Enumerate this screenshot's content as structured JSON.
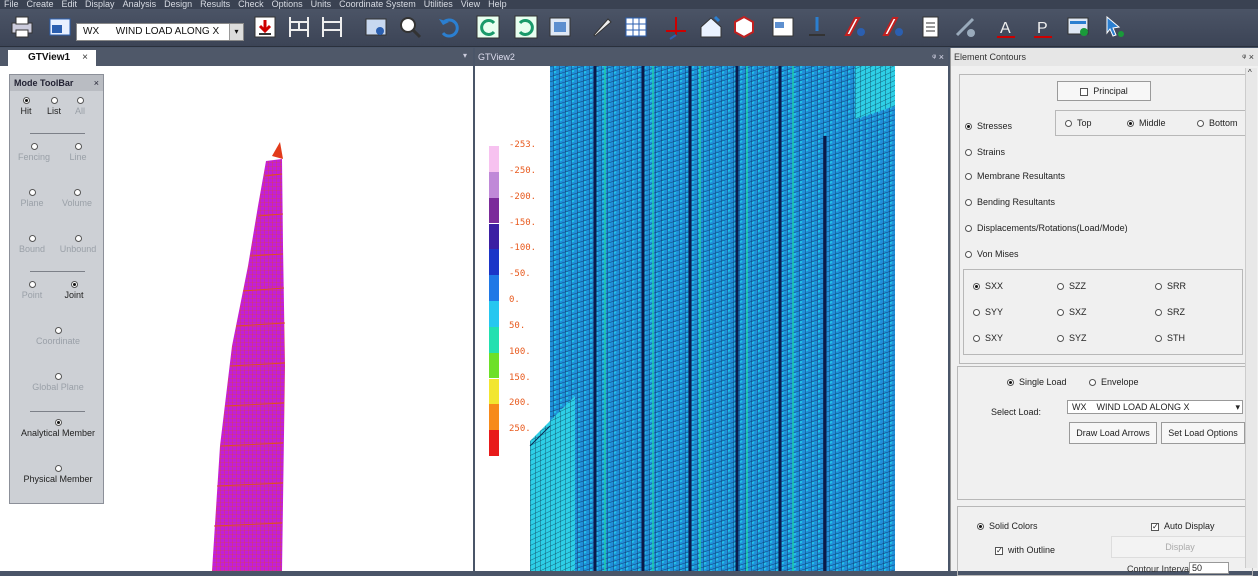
{
  "menu": [
    "File",
    "Create",
    "Edit",
    "Display",
    "Analysis",
    "Design",
    "Results",
    "Check",
    "Options",
    "Units",
    "Coordinate System",
    "Utilities",
    "View",
    "Help"
  ],
  "toolbar": {
    "load_code": "WX",
    "load_name": "WIND LOAD ALONG X",
    "icons": [
      "print-icon",
      "model-icon",
      "download-icon",
      "frame-icon",
      "frame2-icon",
      "image-icon",
      "search-icon",
      "undo-icon",
      "redo-icon",
      "redo2-icon",
      "layout-icon",
      "brush-icon",
      "grid-icon",
      "axis-icon",
      "house-icon",
      "cube-icon",
      "window-icon",
      "support-icon",
      "plate-icon",
      "plate2-icon",
      "report-icon",
      "design-icon",
      "text-a-icon",
      "text-p-icon",
      "display-icon",
      "cursor-icon"
    ]
  },
  "view1": {
    "tab": "GTView1",
    "close": "×"
  },
  "view2": {
    "title": "GTView2",
    "controls": "ᵠ ×"
  },
  "mode_toolbar": {
    "title": "Mode ToolBar",
    "close": "×",
    "row1": [
      "Hit",
      "List",
      "All"
    ],
    "fencing": "Fencing",
    "line": "Line",
    "plane": "Plane",
    "volume": "Volume",
    "bound": "Bound",
    "unbound": "Unbound",
    "point": "Point",
    "joint": "Joint",
    "coordinate": "Coordinate",
    "global_plane": "Global Plane",
    "analytical": "Analytical Member",
    "physical": "Physical Member"
  },
  "legend": {
    "values": [
      "-253.",
      "-250.",
      "-200.",
      "-150.",
      "-100.",
      "-50.",
      "0.",
      "50.",
      "100.",
      "150.",
      "200.",
      "250."
    ],
    "colors": [
      "#f7c2f0",
      "#c089d8",
      "#7b2b9a",
      "#3b1fa3",
      "#1b35c8",
      "#1f78e6",
      "#25c7f0",
      "#22e0b0",
      "#6de028",
      "#f2e630",
      "#f78a1a",
      "#e81b1b"
    ]
  },
  "contours": {
    "title": "Element Contours",
    "controls": "ᵠ ×",
    "principal": "Principal",
    "stresses": "Stresses",
    "top": "Top",
    "middle": "Middle",
    "bottom": "Bottom",
    "strains": "Strains",
    "membrane": "Membrane Resultants",
    "bending": "Bending Resultants",
    "displacements": "Displacements/Rotations(Load/Mode)",
    "von_mises": "Von Mises",
    "comps": [
      "SXX",
      "SZZ",
      "SRR",
      "SYY",
      "SXZ",
      "SRZ",
      "SXY",
      "SYZ",
      "STH"
    ],
    "single_load": "Single Load",
    "envelope": "Envelope",
    "select_load": "Select Load:",
    "load_value": "WX    WIND LOAD ALONG X",
    "draw_arrows": "Draw Load Arrows",
    "set_options": "Set Load Options",
    "solid_colors": "Solid Colors",
    "auto_display": "Auto Display",
    "with_outline": "with Outline",
    "display": "Display",
    "contour_interval": "Contour Interval",
    "interval_value": "50"
  }
}
